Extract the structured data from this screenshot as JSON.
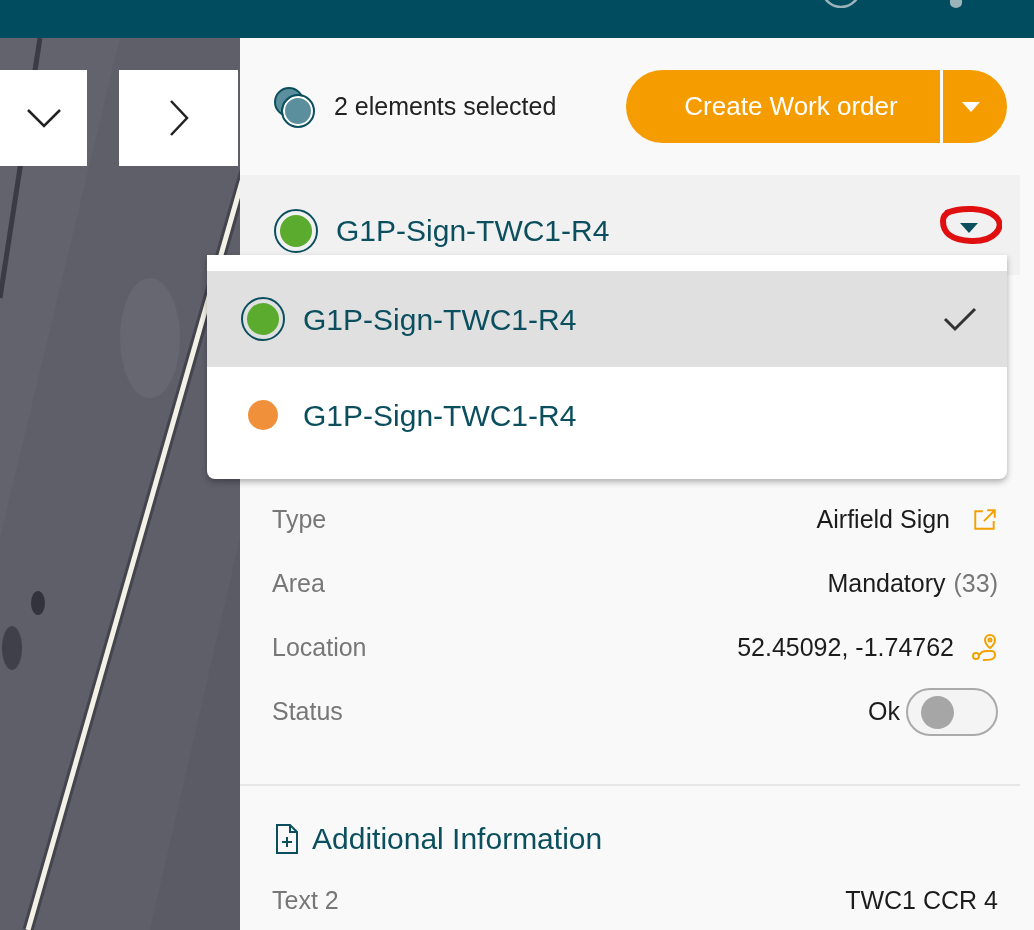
{
  "selection": {
    "count_label": "2 elements selected"
  },
  "create_button": {
    "label": "Create Work order"
  },
  "element_select": {
    "value": "G1P-Sign-TWC1-R4",
    "color": "#5aab2e",
    "expanded": true
  },
  "element_options": [
    {
      "label": "G1P-Sign-TWC1-R4",
      "color": "#5aab2e",
      "selected": true
    },
    {
      "label": "G1P-Sign-TWC1-R4",
      "color": "#f0903a",
      "selected": false
    }
  ],
  "properties": [
    {
      "kind": "link",
      "label": "Type",
      "value": "Airfield Sign"
    },
    {
      "kind": "count",
      "label": "Area",
      "value": "Mandatory",
      "count": "(33)"
    },
    {
      "kind": "location",
      "label": "Location",
      "value": "52.45092, -1.74762"
    },
    {
      "kind": "toggle",
      "label": "Status",
      "value": "Ok",
      "on": false
    }
  ],
  "additional_information": {
    "title": "Additional Information",
    "fields": [
      {
        "label": "Text 2",
        "value": "TWC1 CCR 4"
      }
    ]
  }
}
